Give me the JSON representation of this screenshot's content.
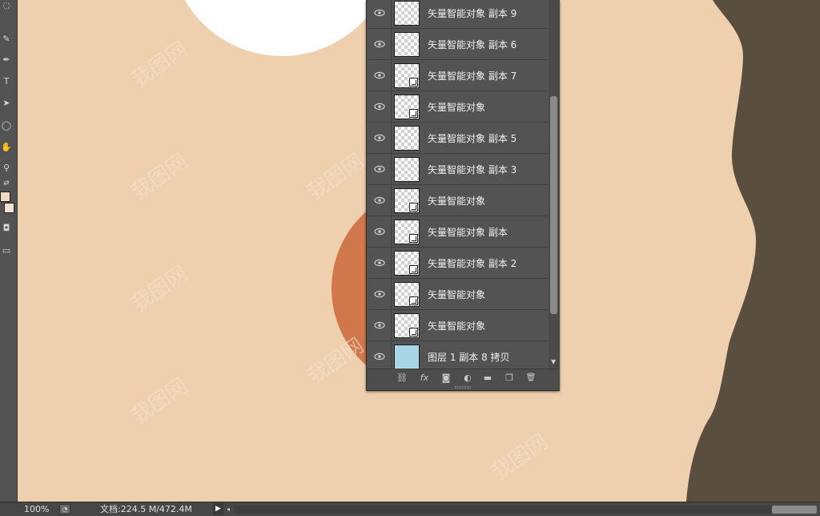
{
  "tools": [
    {
      "icon": "lasso-tool-icon",
      "glyph": "◌"
    },
    {
      "icon": "quick-select-icon",
      "glyph": "✎"
    },
    {
      "icon": "pen-tool-icon",
      "glyph": "✒"
    },
    {
      "icon": "type-tool-icon",
      "glyph": "T"
    },
    {
      "icon": "path-select-icon",
      "glyph": "➤"
    },
    {
      "icon": "ellipse-tool-icon",
      "glyph": "◯"
    },
    {
      "icon": "hand-tool-icon",
      "glyph": "✋"
    },
    {
      "icon": "zoom-tool-icon",
      "glyph": "⚲"
    },
    {
      "icon": "swap-colors-icon",
      "glyph": "⇄"
    },
    {
      "icon": "quick-mask-icon",
      "glyph": "◘"
    },
    {
      "icon": "screen-mode-icon",
      "glyph": "▭"
    }
  ],
  "colors": {
    "foreground": "#f0d9c5",
    "background": "#f6e3d6",
    "canvas_bg": "#eecfae",
    "dark_shape": "#5a4e3e",
    "white_circle": "#ffffff",
    "orange_circle": "#d0774b"
  },
  "layers": [
    {
      "name": "矢量智能对象 副本 9",
      "smart": false,
      "thumb": "checker"
    },
    {
      "name": "矢量智能对象 副本 6",
      "smart": false,
      "thumb": "checker"
    },
    {
      "name": "矢量智能对象 副本 7",
      "smart": true,
      "thumb": "checker"
    },
    {
      "name": "矢量智能对象",
      "smart": true,
      "thumb": "checker"
    },
    {
      "name": "矢量智能对象 副本 5",
      "smart": false,
      "thumb": "checker"
    },
    {
      "name": "矢量智能对象 副本 3",
      "smart": false,
      "thumb": "checker"
    },
    {
      "name": "矢量智能对象",
      "smart": true,
      "thumb": "checker"
    },
    {
      "name": "矢量智能对象 副本",
      "smart": true,
      "thumb": "checker"
    },
    {
      "name": "矢量智能对象 副本 2",
      "smart": true,
      "thumb": "checker"
    },
    {
      "name": "矢量智能对象",
      "smart": true,
      "thumb": "checker"
    },
    {
      "name": "矢量智能对象",
      "smart": true,
      "thumb": "checker"
    },
    {
      "name": "图层 1 副本 8 拷贝",
      "smart": false,
      "thumb": "blue"
    }
  ],
  "panel_footer": [
    {
      "icon": "link-layers-icon",
      "glyph": "⛓"
    },
    {
      "icon": "fx-icon",
      "glyph": "fx"
    },
    {
      "icon": "add-mask-icon",
      "glyph": "◙"
    },
    {
      "icon": "adjustment-layer-icon",
      "glyph": "◐"
    },
    {
      "icon": "new-group-icon",
      "glyph": "▬"
    },
    {
      "icon": "new-layer-icon",
      "glyph": "❐"
    },
    {
      "icon": "delete-layer-icon",
      "glyph": "🗑"
    }
  ],
  "status": {
    "zoom": "100%",
    "doc_info": "文档:224.5 M/472.4M",
    "arrow": "▶",
    "scroll_left": "◂"
  }
}
